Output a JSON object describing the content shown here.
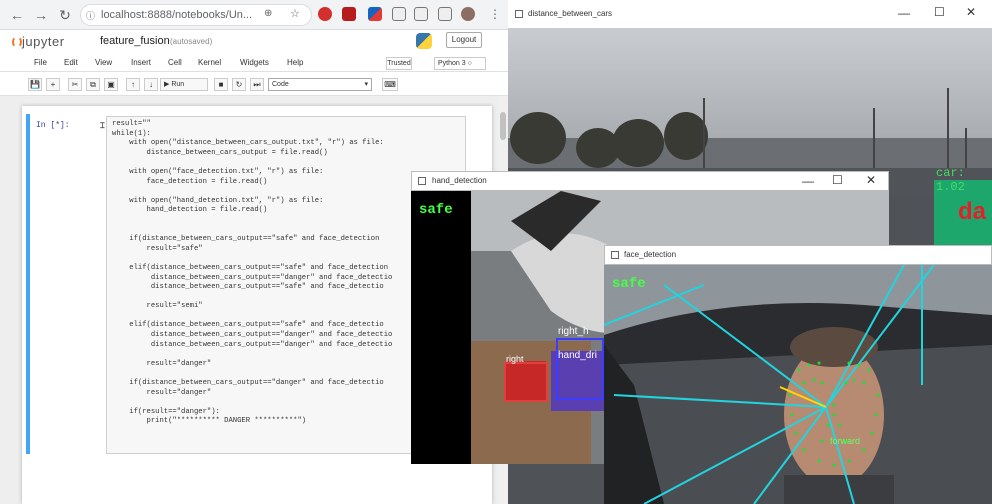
{
  "browser": {
    "url": "localhost:8888/notebooks/Un...",
    "nav_back": "←",
    "nav_forward": "→",
    "nav_reload": "↻"
  },
  "jupyter": {
    "logo_text": "jupyter",
    "notebook_name": "feature_fusion",
    "notebook_status": "(autosaved)",
    "logout": "Logout",
    "menu": [
      "File",
      "Edit",
      "View",
      "Insert",
      "Cell",
      "Kernel",
      "Widgets",
      "Help"
    ],
    "trusted": "Trusted",
    "kernel": "Python 3 ○",
    "toolbar_buttons": [
      "💾",
      "+",
      "✂",
      "⧉",
      "▣",
      "↑",
      "↓"
    ],
    "run_label": "▶ Run",
    "after_run_buttons": [
      "■",
      "↻",
      "⏭"
    ],
    "cell_type": "Code",
    "cell_prompt": "In [*]:",
    "code": "result=\"\"\nwhile(1):\n    with open(\"distance_between_cars_output.txt\", \"r\") as file:\n        distance_between_cars_output = file.read()\n\n    with open(\"face_detection.txt\", \"r\") as file:\n        face_detection = file.read()\n\n    with open(\"hand_detection.txt\", \"r\") as file:\n        hand_detection = file.read()\n\n\n    if(distance_between_cars_output==\"safe\" and face_detection\n        result=\"safe\"\n\n    elif(distance_between_cars_output==\"safe\" and face_detection\n         distance_between_cars_output==\"danger\" and face_detectio\n         distance_between_cars_output==\"safe\" and face_detectio\n\n        result=\"semi\"\n\n    elif(distance_between_cars_output==\"safe\" and face_detectio\n         distance_between_cars_output==\"danger\" and face_detectio\n         distance_between_cars_output==\"danger\" and face_detectio\n\n        result=\"danger\"\n\n    if(distance_between_cars_output==\"danger\" and face_detectio\n        result=\"danger\"\n\n    if(result==\"danger\"):\n        print(\"********** DANGER **********\")"
  },
  "windows": {
    "distance": {
      "title": "distance_between_cars",
      "label": "car: 1.02",
      "status": "da"
    },
    "hand": {
      "title": "hand_detection",
      "status": "safe",
      "label_right": "right_h",
      "label_hand_driving": "hand_dri",
      "label_right2": "right"
    },
    "face": {
      "title": "face_detection",
      "status": "safe",
      "direction": "forward"
    },
    "controls": {
      "minimize": "—",
      "maximize": "☐",
      "close": "✕"
    }
  },
  "colors": {
    "status_safe": "#44ff44",
    "status_danger": "#e0202a",
    "cell_active": "#42a5f5",
    "face_mesh": "#20d4e0"
  }
}
